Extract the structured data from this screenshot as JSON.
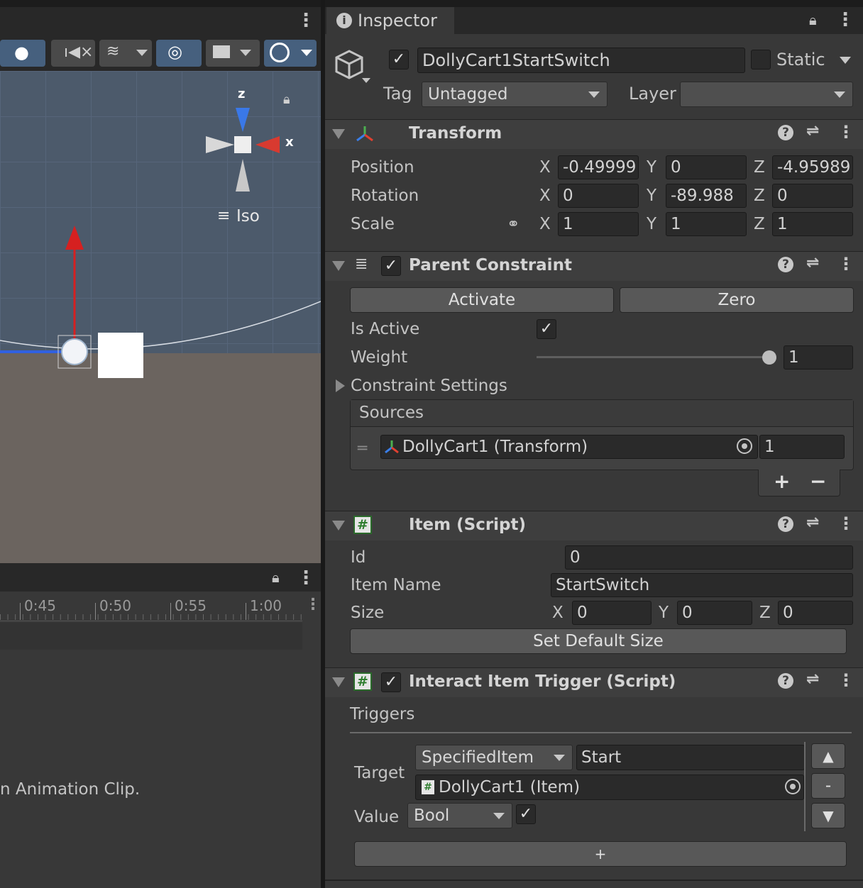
{
  "scene": {
    "gizmo_axis_z": "z",
    "gizmo_axis_x": "x",
    "projection_label": "Iso"
  },
  "timeline": {
    "ticks": [
      "0:45",
      "0:50",
      "0:55",
      "1:00"
    ],
    "message_fragment": "n Animation Clip."
  },
  "inspector": {
    "tab_label": "Inspector",
    "object": {
      "active": true,
      "name": "DollyCart1StartSwitch",
      "static_label": "Static",
      "static": false,
      "tag_label": "Tag",
      "tag_value": "Untagged",
      "layer_label": "Layer",
      "layer_value": ""
    },
    "transform": {
      "title": "Transform",
      "position_label": "Position",
      "rotation_label": "Rotation",
      "scale_label": "Scale",
      "axis_x": "X",
      "axis_y": "Y",
      "axis_z": "Z",
      "position": {
        "x": "-0.49999",
        "y": "0",
        "z": "-4.95989"
      },
      "rotation": {
        "x": "0",
        "y": "-89.988",
        "z": "0"
      },
      "scale": {
        "x": "1",
        "y": "1",
        "z": "1"
      }
    },
    "parent_constraint": {
      "title": "Parent Constraint",
      "enabled": true,
      "activate_button": "Activate",
      "zero_button": "Zero",
      "is_active_label": "Is Active",
      "is_active": true,
      "weight_label": "Weight",
      "weight_value": "1",
      "weight_fraction": 1.0,
      "constraint_settings_label": "Constraint Settings",
      "sources_label": "Sources",
      "sources": [
        {
          "name": "DollyCart1 (Transform)",
          "weight": "1"
        }
      ],
      "add_symbol": "+",
      "remove_symbol": "−"
    },
    "item_script": {
      "title": "Item (Script)",
      "id_label": "Id",
      "id_value": "0",
      "item_name_label": "Item Name",
      "item_name_value": "StartSwitch",
      "size_label": "Size",
      "size": {
        "x": "0",
        "y": "0",
        "z": "0"
      },
      "set_default_size_button": "Set Default Size"
    },
    "interact_trigger": {
      "title": "Interact Item Trigger (Script)",
      "enabled": true,
      "triggers_label": "Triggers",
      "target_label": "Target",
      "target_mode": "SpecifiedItem",
      "target_event": "Start",
      "target_object": "DollyCart1 (Item)",
      "value_label": "Value",
      "value_type": "Bool",
      "value_checked": true,
      "move_up": "▲",
      "remove": "-",
      "move_down": "▼",
      "add_button": "+"
    }
  }
}
